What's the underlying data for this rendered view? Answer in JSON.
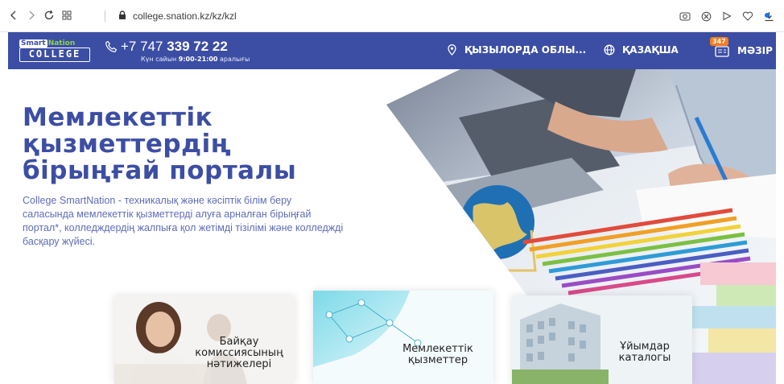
{
  "browser": {
    "url": "college.snation.kz/kz/kzl",
    "icons": [
      "back-icon",
      "forward-icon",
      "reload-icon",
      "apps-icon",
      "lock-icon",
      "screenshot-icon",
      "shield-icon",
      "send-icon",
      "heart-icon",
      "download-icon"
    ]
  },
  "header": {
    "logo_top_1": "Smart",
    "logo_top_2": "Nation",
    "logo_main": "COLLEGE",
    "phone_prefix": "+7 747 ",
    "phone_main": "339 72 22",
    "hours_prefix": "Күн сайын ",
    "hours_time": "9:00-21:00",
    "hours_suffix": " аралығы",
    "region": "ҚЫЗЫЛОРДА ОБЛЫ...",
    "language": "ҚАЗАҚША",
    "menu_badge": "347",
    "menu_label": "МӘЗІР",
    "colors": {
      "bar": "#3c4ea4",
      "badge": "#f57c1f"
    }
  },
  "hero": {
    "title": "Мемлекеттік қызметтердің бірыңғай порталы",
    "description": "College SmartNation - техникалық және кәсіптік білім беру саласында мемлекеттік қызметтерді алуға арналған бірыңғай портал*, колледждердің жалпыға қол жетімді тізілімі және колледжді басқару жүйесі.",
    "title_color": "#3c4ea4"
  },
  "cards": [
    {
      "label": "Байқау комиссиясының нәтижелері"
    },
    {
      "label": "Мемлекеттік қызметтер"
    },
    {
      "label": "Ұйымдар каталогы"
    }
  ]
}
